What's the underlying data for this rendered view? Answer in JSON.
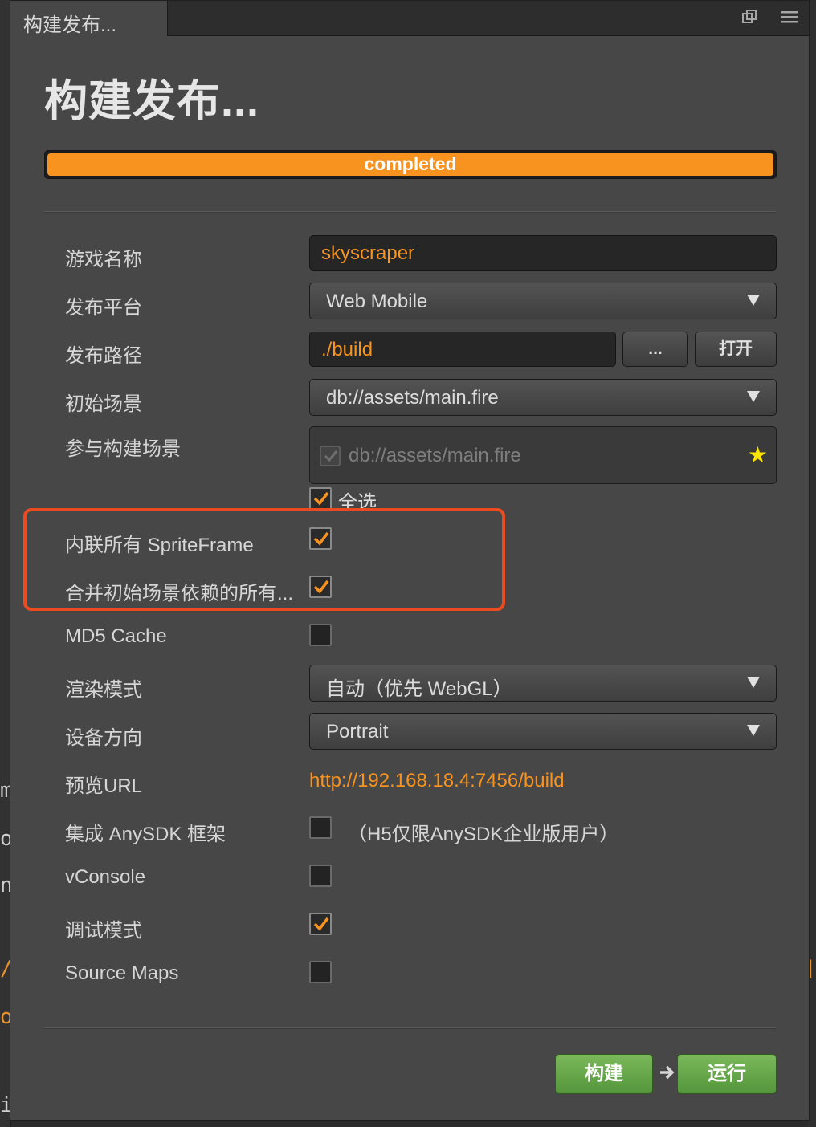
{
  "window": {
    "tab_title": "构建发布...",
    "heading": "构建发布..."
  },
  "progress": {
    "label": "completed",
    "value_percent": 100,
    "color": "#f7931e"
  },
  "fields": {
    "game_name": {
      "label": "游戏名称",
      "value": "skyscraper"
    },
    "platform": {
      "label": "发布平台",
      "value": "Web Mobile"
    },
    "build_path": {
      "label": "发布路径",
      "value": "./build",
      "browse_label": "...",
      "open_label": "打开"
    },
    "start_scene": {
      "label": "初始场景",
      "value": "db://assets/main.fire"
    },
    "included_scenes": {
      "label": "参与构建场景",
      "scene": "db://assets/main.fire",
      "select_all_label": "全选"
    },
    "inline_spriteframe": {
      "label": "内联所有 SpriteFrame",
      "checked": true
    },
    "merge_start_scene": {
      "label": "合并初始场景依赖的所有...",
      "checked": true
    },
    "md5_cache": {
      "label": "MD5 Cache",
      "checked": false
    },
    "render_mode": {
      "label": "渲染模式",
      "value": "自动（优先 WebGL）"
    },
    "orientation": {
      "label": "设备方向",
      "value": "Portrait"
    },
    "preview_url": {
      "label": "预览URL",
      "value": "http://192.168.18.4:7456/build"
    },
    "anysdk": {
      "label": "集成 AnySDK 框架",
      "checked": false,
      "note": "（H5仅限AnySDK企业版用户）"
    },
    "vconsole": {
      "label": "vConsole",
      "checked": false
    },
    "debug_mode": {
      "label": "调试模式",
      "checked": true
    },
    "source_maps": {
      "label": "Source Maps",
      "checked": false
    }
  },
  "actions": {
    "build_label": "构建",
    "run_label": "运行"
  },
  "colors": {
    "accent": "#f7931e",
    "panel": "#474747",
    "highlight_border": "#ec4a1f",
    "action_green": "#66a84a"
  }
}
